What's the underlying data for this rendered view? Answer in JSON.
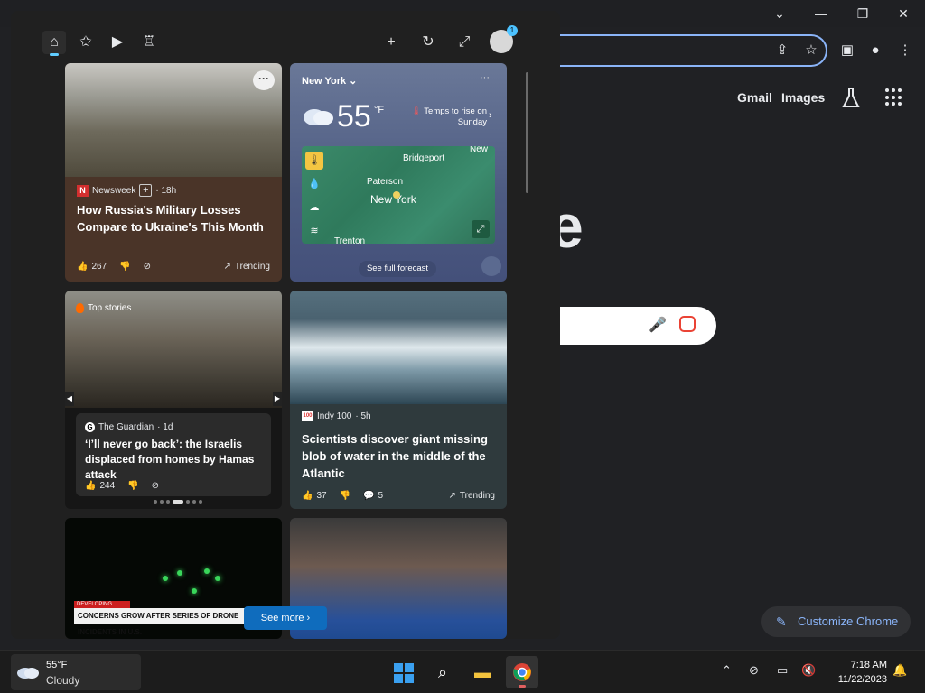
{
  "chrome": {
    "links": {
      "gmail": "Gmail",
      "images": "Images"
    },
    "logo_fragment": "e",
    "customize_label": "Customize Chrome"
  },
  "widgets": {
    "cards": {
      "russia": {
        "source": "Newsweek",
        "age": "· 18h",
        "headline": "How Russia's Military Losses Compare to Ukraine's This Month",
        "likes": "267",
        "trending": "Trending"
      },
      "weather": {
        "location": "New York",
        "temp": "55",
        "unit": "°F",
        "note": "Temps to rise on Sunday",
        "map_labels": {
          "bridgeport": "Bridgeport",
          "paterson": "Paterson",
          "new_york": "New York",
          "trenton": "Trenton",
          "new_top": "New"
        },
        "forecast_label": "See full forecast"
      },
      "top_stories": {
        "tag": "Top stories",
        "source": "The Guardian",
        "age": "· 1d",
        "headline": "‘I’ll never go back’: the Israelis displaced from homes by Hamas attack",
        "likes": "244"
      },
      "science": {
        "source": "Indy 100",
        "age": "· 5h",
        "headline": "Scientists discover giant missing blob of water in the middle of the Atlantic",
        "likes": "37",
        "comments": "5",
        "trending": "Trending"
      },
      "drone": {
        "developing": "DEVELOPING STORY",
        "crawl": "CONCERNS GROW AFTER SERIES OF DRONE INCIDENTS IN U.S."
      }
    },
    "see_more": "See more",
    "notification_count": "1"
  },
  "taskbar": {
    "weather_temp": "55°F",
    "weather_desc": "Cloudy",
    "time": "7:18 AM",
    "date": "11/22/2023"
  }
}
